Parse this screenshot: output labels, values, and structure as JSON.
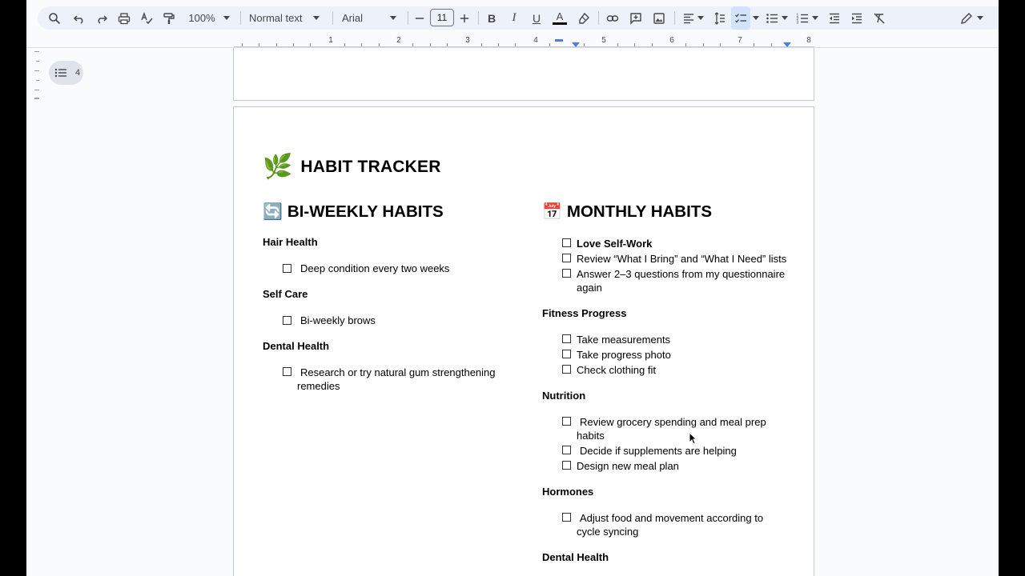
{
  "toolbar": {
    "zoom": "100%",
    "style": "Normal text",
    "font": "Arial",
    "font_size": "11"
  },
  "ruler": {
    "numbers": [
      "1",
      "2",
      "3",
      "4",
      "5",
      "6",
      "7",
      "8"
    ]
  },
  "outline": {
    "count": "4"
  },
  "document": {
    "title_emoji": "🌿",
    "title": "HABIT TRACKER",
    "left": {
      "heading_emoji": "🔄",
      "heading": "BI-WEEKLY HABITS",
      "sections": [
        {
          "title": "Hair Health",
          "items": [
            "Deep condition every two weeks"
          ]
        },
        {
          "title": "Self Care",
          "items": [
            "Bi-weekly brows"
          ]
        },
        {
          "title": "Dental Health",
          "items": [
            "Research or try natural gum strengthening",
            "remedies"
          ]
        }
      ]
    },
    "right": {
      "heading_emoji": "📅",
      "heading": "MONTHLY HABITS",
      "top_items": [
        "Love Self-Work",
        "Review “What I Bring” and “What I Need” lists",
        "Answer 2–3 questions from my questionnaire",
        "again"
      ],
      "sections": [
        {
          "title": "Fitness Progress",
          "items": [
            "Take measurements",
            "Take progress photo",
            "Check clothing fit"
          ]
        },
        {
          "title": "Nutrition",
          "items": [
            "Review grocery spending and meal prep",
            "habits",
            "Decide if supplements are helping",
            "Design new meal plan"
          ]
        },
        {
          "title": "Hormones",
          "items": [
            "Adjust food and movement according to",
            "cycle syncing"
          ]
        },
        {
          "title": "Dental Health",
          "items": []
        }
      ]
    }
  }
}
